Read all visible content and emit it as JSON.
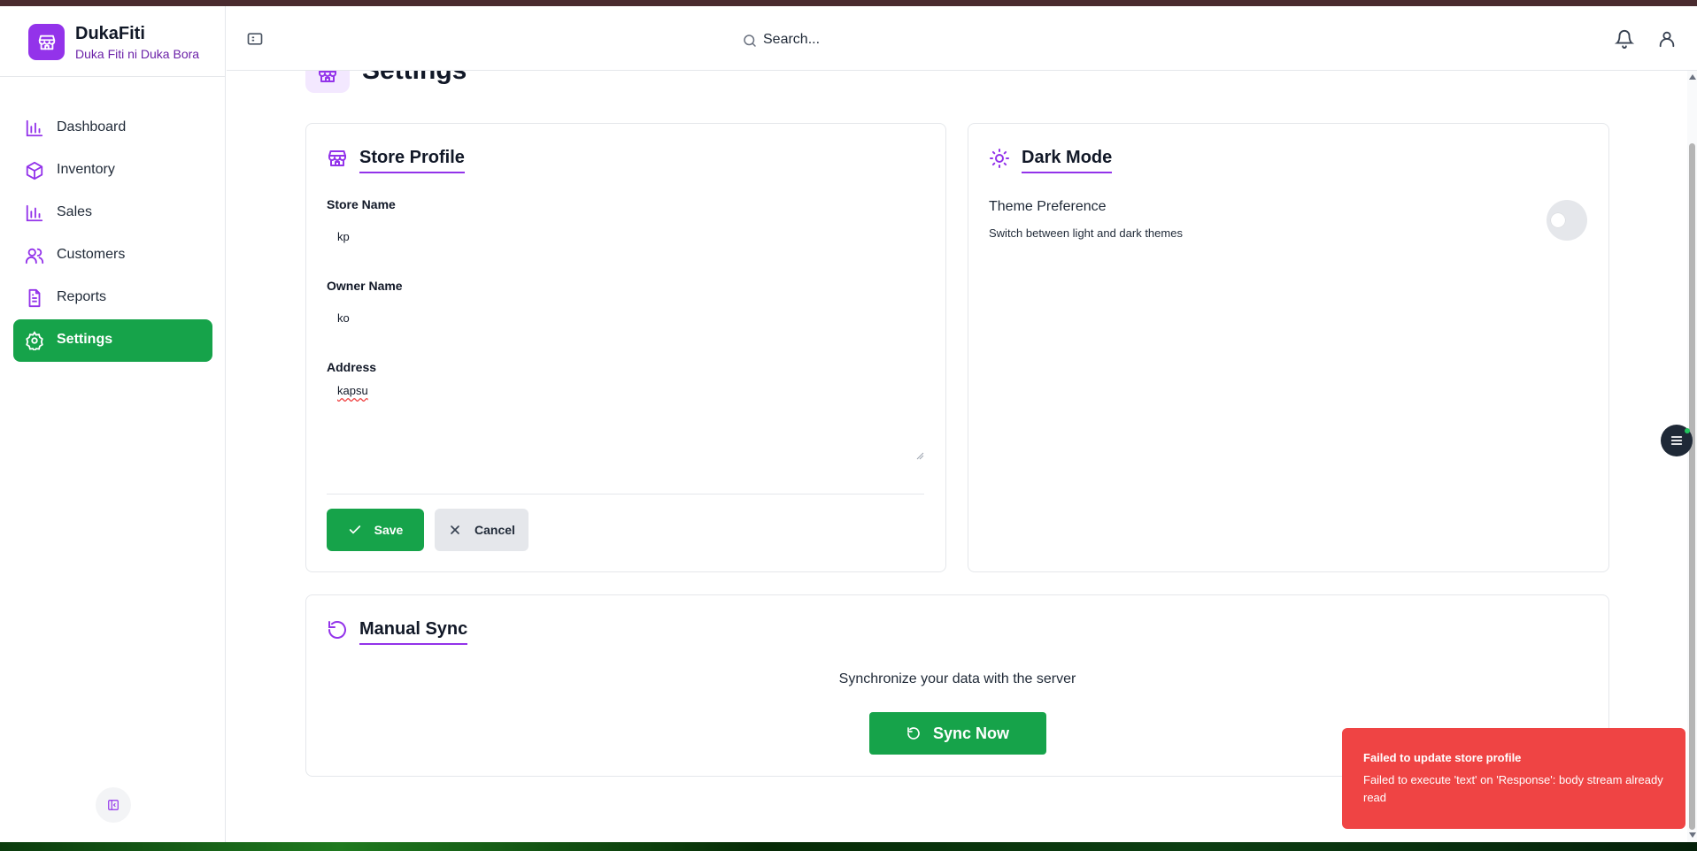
{
  "app": {
    "name": "DukaFiti",
    "tagline": "Duka Fiti ni Duka Bora",
    "logo_icon": "store-icon",
    "accent_color": "#9333ea",
    "primary_color": "#16a34a"
  },
  "sidebar": {
    "items": [
      {
        "label": "Dashboard",
        "icon": "bar-chart-icon"
      },
      {
        "label": "Inventory",
        "icon": "package-icon"
      },
      {
        "label": "Sales",
        "icon": "bar-chart-icon"
      },
      {
        "label": "Customers",
        "icon": "users-icon"
      },
      {
        "label": "Reports",
        "icon": "file-text-icon"
      },
      {
        "label": "Settings",
        "icon": "gear-icon",
        "active": true
      }
    ],
    "collapse_icon": "panel-left-close-icon"
  },
  "header": {
    "search_placeholder": "Search...",
    "icons": [
      "sidebar-toggle-icon",
      "search-icon",
      "bell-icon",
      "user-icon"
    ]
  },
  "page": {
    "title": "Settings",
    "icon": "store-icon"
  },
  "store_profile": {
    "title": "Store Profile",
    "store_name_label": "Store Name",
    "store_name_value": "kp",
    "owner_name_label": "Owner Name",
    "owner_name_value": "ko",
    "address_label": "Address",
    "address_value": "kapsu",
    "save_label": "Save",
    "cancel_label": "Cancel"
  },
  "dark_mode": {
    "title": "Dark Mode",
    "preference_label": "Theme Preference",
    "preference_desc": "Switch between light and dark themes",
    "enabled": false
  },
  "manual_sync": {
    "title": "Manual Sync",
    "description": "Synchronize your data with the server",
    "button_label": "Sync Now"
  },
  "toast": {
    "title": "Failed to update store profile",
    "message": "Failed to execute 'text' on 'Response': body stream already read",
    "color": "#ef4444"
  }
}
